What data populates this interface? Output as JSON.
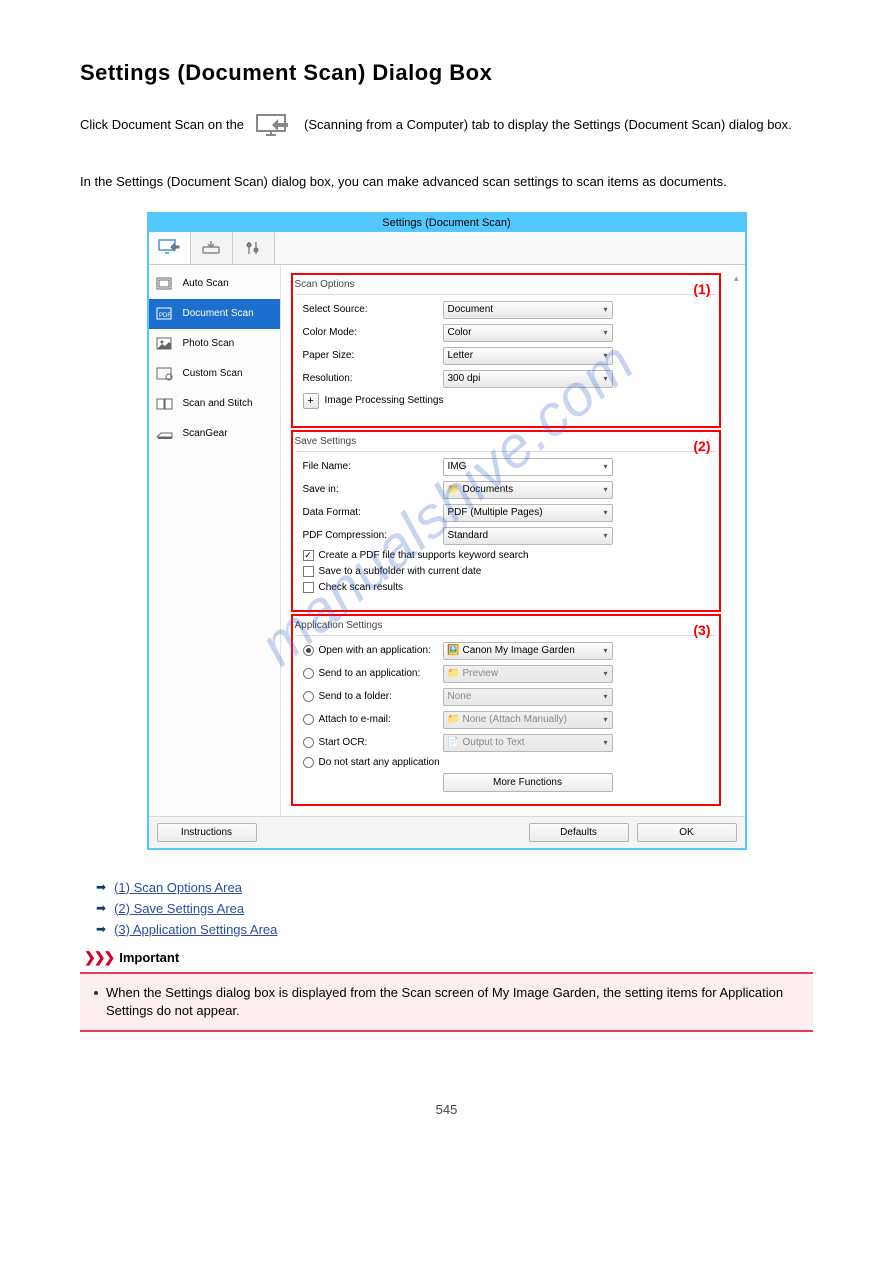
{
  "page": {
    "heading": "Settings (Document Scan) Dialog Box",
    "intro_before": "Click Document Scan on the ",
    "intro_after": " (Scanning from a Computer) tab to display the Settings (Document Scan) dialog box.",
    "intro2": "In the Settings (Document Scan) dialog box, you can make advanced scan settings to scan items as documents.",
    "page_number": "545"
  },
  "dialog": {
    "title": "Settings (Document Scan)",
    "sidebar": {
      "items": [
        {
          "label": "Auto Scan"
        },
        {
          "label": "Document Scan"
        },
        {
          "label": "Photo Scan"
        },
        {
          "label": "Custom Scan"
        },
        {
          "label": "Scan and Stitch"
        },
        {
          "label": "ScanGear"
        }
      ]
    },
    "scan_options": {
      "legend": "Scan Options",
      "select_source_label": "Select Source:",
      "select_source_value": "Document",
      "color_mode_label": "Color Mode:",
      "color_mode_value": "Color",
      "paper_size_label": "Paper Size:",
      "paper_size_value": "Letter",
      "resolution_label": "Resolution:",
      "resolution_value": "300 dpi",
      "image_processing_label": "Image Processing Settings",
      "num": "(1)"
    },
    "save_settings": {
      "legend": "Save Settings",
      "file_name_label": "File Name:",
      "file_name_value": "IMG",
      "save_in_label": "Save in:",
      "save_in_value": "Documents",
      "data_format_label": "Data Format:",
      "data_format_value": "PDF (Multiple Pages)",
      "pdf_compression_label": "PDF Compression:",
      "pdf_compression_value": "Standard",
      "chk_keyword": "Create a PDF file that supports keyword search",
      "chk_subfolder": "Save to a subfolder with current date",
      "chk_results": "Check scan results",
      "num": "(2)"
    },
    "app_settings": {
      "legend": "Application Settings",
      "open_app_label": "Open with an application:",
      "open_app_value": "Canon My Image Garden",
      "send_app_label": "Send to an application:",
      "send_app_value": "Preview",
      "send_folder_label": "Send to a folder:",
      "send_folder_value": "None",
      "attach_label": "Attach to e-mail:",
      "attach_value": "None (Attach Manually)",
      "ocr_label": "Start OCR:",
      "ocr_value": "Output to Text",
      "no_app_label": "Do not start any application",
      "more_functions": "More Functions",
      "num": "(3)"
    },
    "footer": {
      "instructions": "Instructions",
      "defaults": "Defaults",
      "ok": "OK"
    }
  },
  "links": {
    "l1": "(1) Scan Options Area",
    "l2": "(2) Save Settings Area",
    "l3": "(3) Application Settings Area"
  },
  "important": {
    "heading": "Important",
    "text": "When the Settings dialog box is displayed from the Scan screen of My Image Garden, the setting items for Application Settings do not appear."
  },
  "watermark": "manualshive.com"
}
